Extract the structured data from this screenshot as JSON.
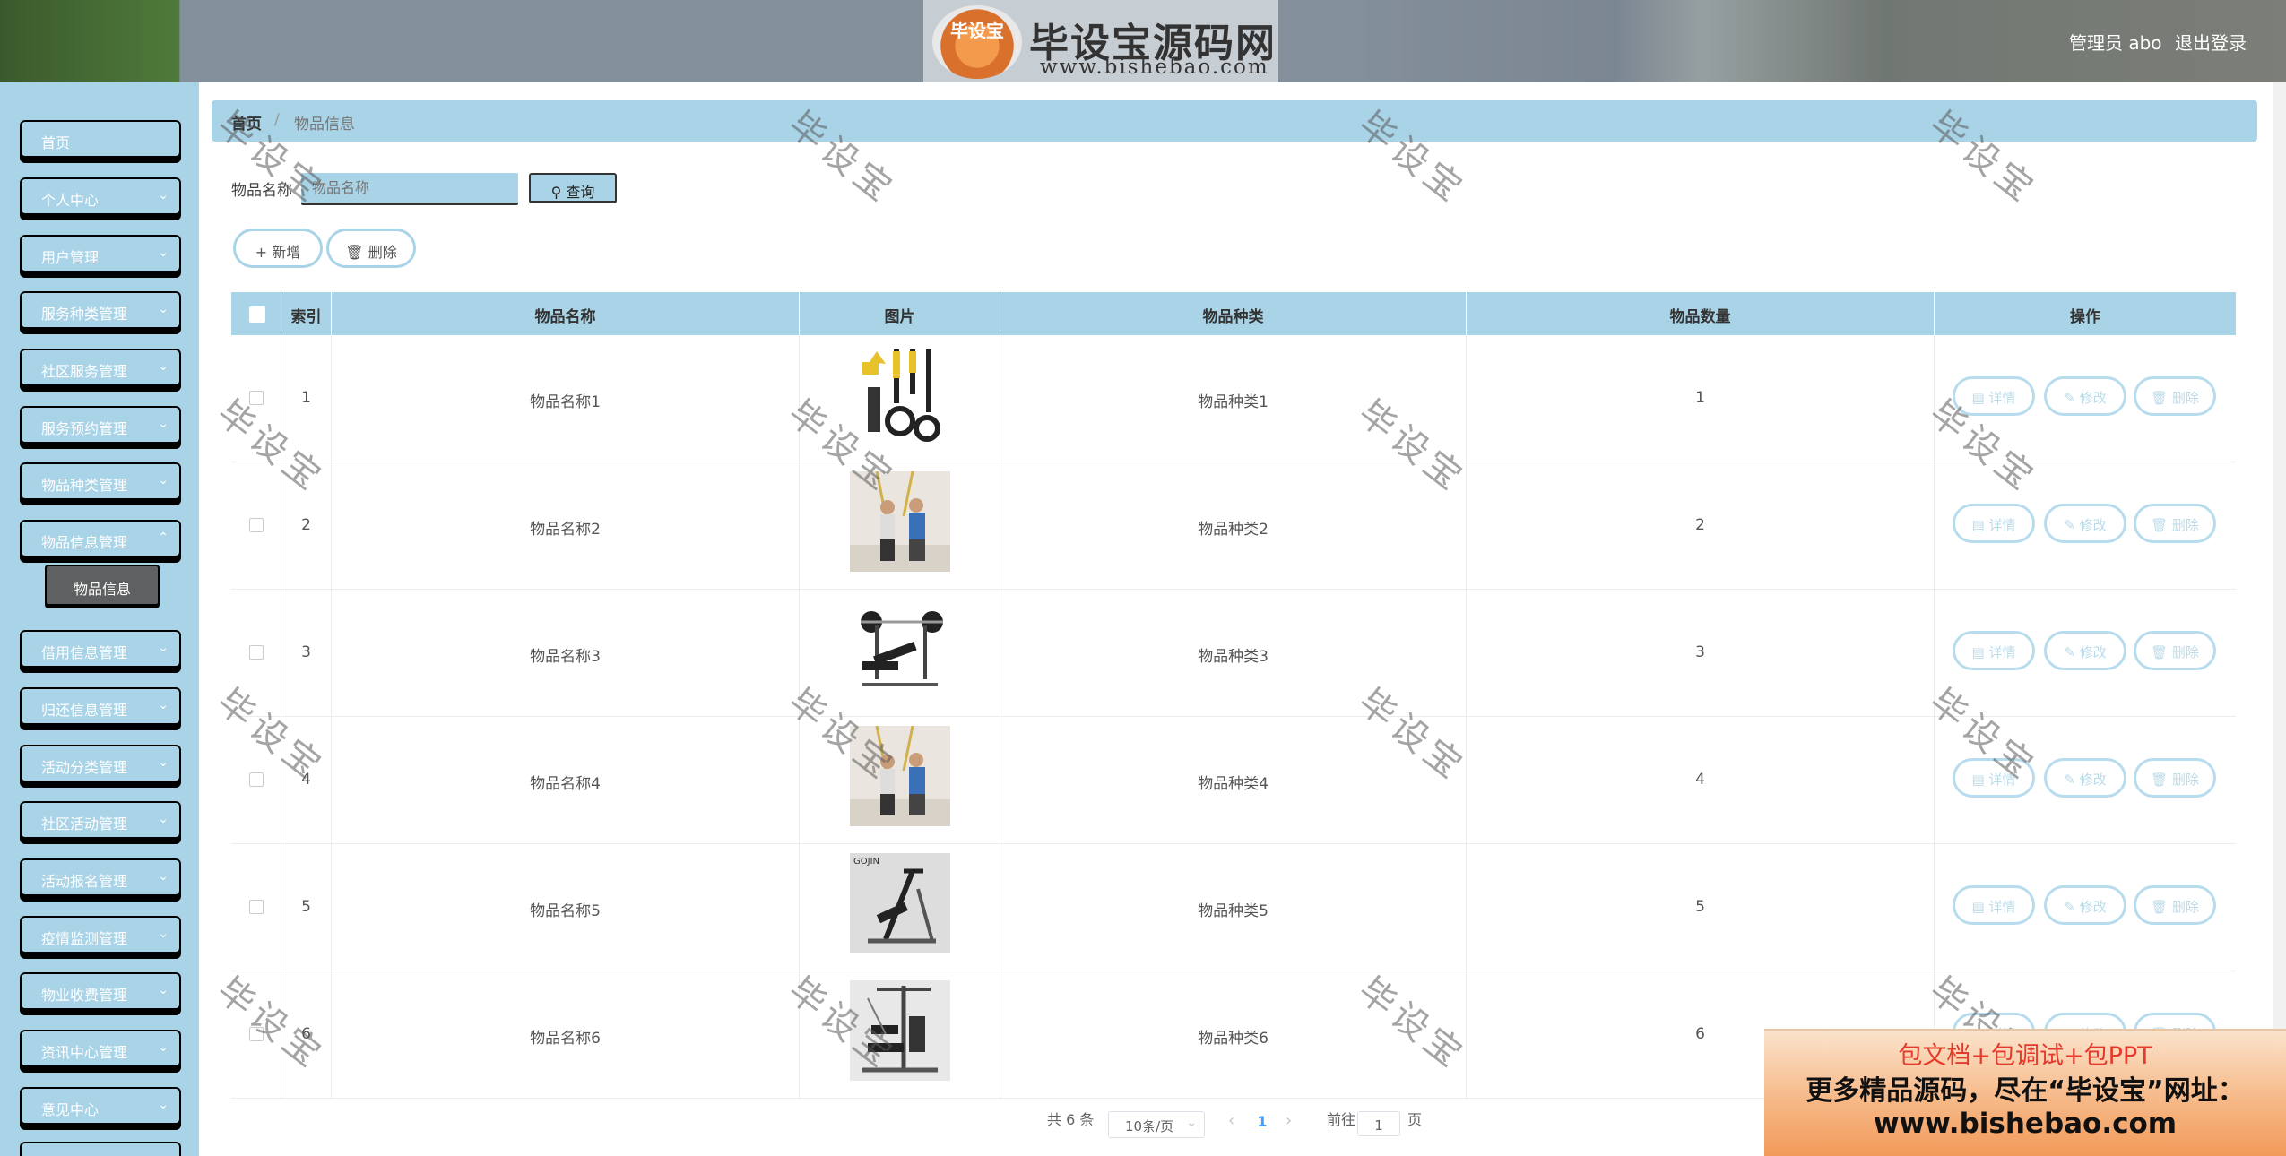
{
  "header": {
    "logo_badge": "毕设宝",
    "logo_title": "毕设宝源码网",
    "logo_url": "www.bishebao.com",
    "admin_label": "管理员 abo",
    "logout_label": "退出登录"
  },
  "sidebar": {
    "items": [
      {
        "label": "首页",
        "has_chevron": false
      },
      {
        "label": "个人中心",
        "has_chevron": true
      },
      {
        "label": "用户管理",
        "has_chevron": true
      },
      {
        "label": "服务种类管理",
        "has_chevron": true
      },
      {
        "label": "社区服务管理",
        "has_chevron": true
      },
      {
        "label": "服务预约管理",
        "has_chevron": true
      },
      {
        "label": "物品种类管理",
        "has_chevron": true
      },
      {
        "label": "物品信息管理",
        "has_chevron": true
      },
      {
        "label": "借用信息管理",
        "has_chevron": true
      },
      {
        "label": "归还信息管理",
        "has_chevron": true
      },
      {
        "label": "活动分类管理",
        "has_chevron": true
      },
      {
        "label": "社区活动管理",
        "has_chevron": true
      },
      {
        "label": "活动报名管理",
        "has_chevron": true
      },
      {
        "label": "疫情监测管理",
        "has_chevron": true
      },
      {
        "label": "物业收费管理",
        "has_chevron": true
      },
      {
        "label": "资讯中心管理",
        "has_chevron": true
      },
      {
        "label": "意见中心",
        "has_chevron": true
      }
    ],
    "active_sub": "物品信息"
  },
  "breadcrumb": {
    "home": "首页",
    "current": "物品信息"
  },
  "search": {
    "label": "物品名称",
    "placeholder": "物品名称",
    "value": "",
    "button_label": "查询"
  },
  "actions": {
    "add_label": "新增",
    "delete_label": "删除"
  },
  "table": {
    "columns": [
      "索引",
      "物品名称",
      "图片",
      "物品种类",
      "物品数量",
      "操作"
    ],
    "rows": [
      {
        "index": "1",
        "name": "物品名称1",
        "category": "物品种类1",
        "quantity": "1",
        "image": "suspension-trainer-straps"
      },
      {
        "index": "2",
        "name": "物品名称2",
        "category": "物品种类2",
        "quantity": "2",
        "image": "people-training-straps"
      },
      {
        "index": "3",
        "name": "物品名称3",
        "category": "物品种类3",
        "quantity": "3",
        "image": "weight-bench"
      },
      {
        "index": "4",
        "name": "物品名称4",
        "category": "物品种类4",
        "quantity": "4",
        "image": "people-training-straps"
      },
      {
        "index": "5",
        "name": "物品名称5",
        "category": "物品种类5",
        "quantity": "5",
        "image": "ab-machine"
      },
      {
        "index": "6",
        "name": "物品名称6",
        "category": "物品种类6",
        "quantity": "6",
        "image": "home-gym-station"
      }
    ],
    "row_actions": {
      "detail": "详情",
      "edit": "修改",
      "delete": "删除"
    }
  },
  "pagination": {
    "total_label": "共 6 条",
    "page_size": "10条/页",
    "current_page": "1",
    "jump_prefix": "前往",
    "jump_value": "1",
    "jump_suffix": "页"
  },
  "ad_banner": {
    "line1": "包文档+包调试+包PPT",
    "line2": "更多精品源码，尽在“毕设宝”网址：",
    "line3": "www.bishebao.com"
  },
  "watermark": "毕设宝",
  "colors": {
    "accent": "#a9d3e6",
    "active_sub_bg": "#5f6061",
    "pager_active": "#409eff",
    "ad_text_red": "#e53a2b"
  }
}
